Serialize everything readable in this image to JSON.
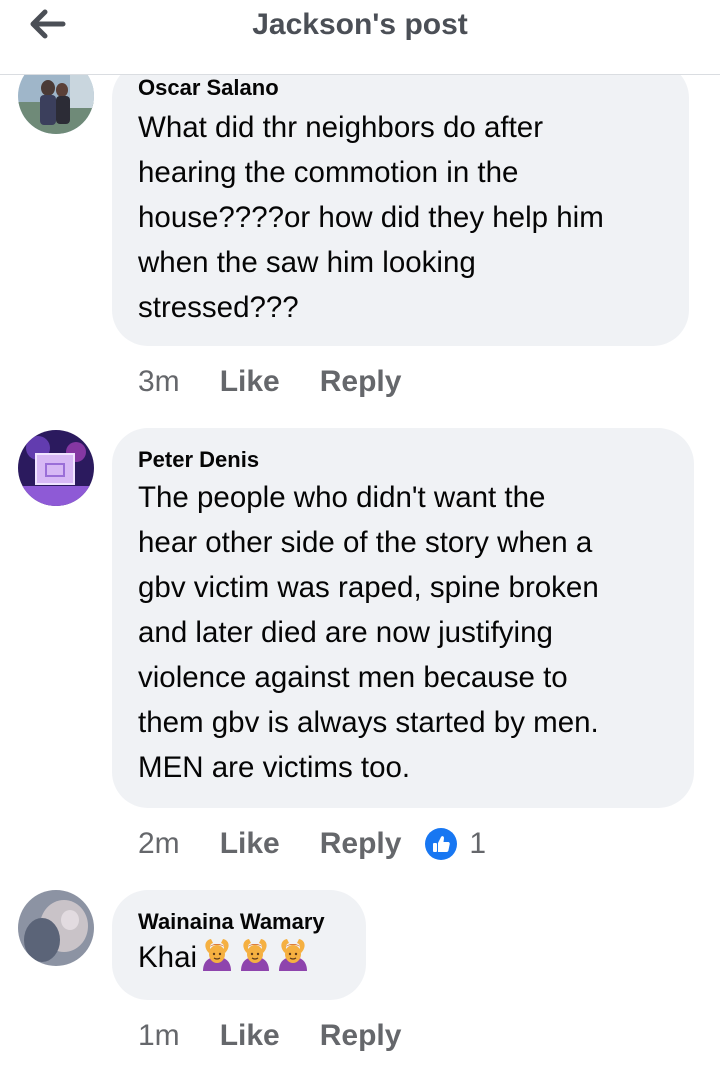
{
  "header": {
    "title": "Jackson's post",
    "back_icon": "arrow-left-icon"
  },
  "comments": [
    {
      "author": "Oscar Salano",
      "text": "What did thr neighbors do after\nhearing the commotion in the\nhouse????or how did they help him\nwhen the saw him looking\nstressed???",
      "time": "3m",
      "like": "Like",
      "reply": "Reply"
    },
    {
      "author": "Peter Denis",
      "text": "The people who didn't want the\nhear other side of the story when a\ngbv victim was raped, spine broken\nand later died are now justifying\nviolence against men because to\nthem gbv is always started by men.\nMEN are victims too.",
      "time": "2m",
      "like": "Like",
      "reply": "Reply",
      "reaction_icon": "thumbs-up-icon",
      "reaction_count": "1"
    },
    {
      "author": "Wainaina Wamary",
      "text": "Khai",
      "emoji_icon": "person-gesturing-ok-emoji",
      "time": "1m",
      "like": "Like",
      "reply": "Reply"
    }
  ],
  "colors": {
    "accent": "#1877f2",
    "bubble": "#f0f2f5",
    "meta": "#65676b",
    "title": "#4b4f56"
  }
}
